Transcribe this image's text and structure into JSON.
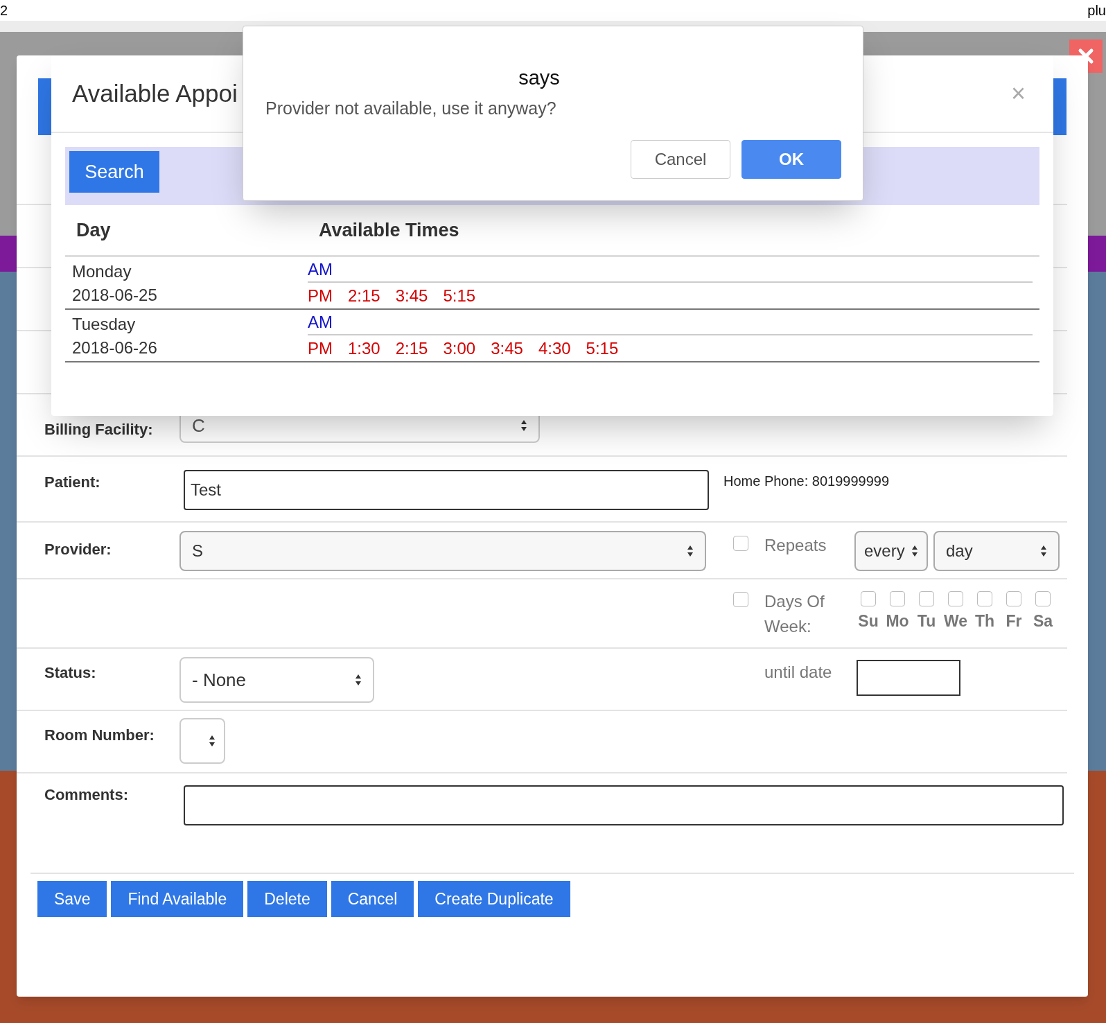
{
  "browser_bar": {
    "left_text": "2",
    "right_text": "plu"
  },
  "appointment_form": {
    "billing_facility": {
      "label": "Billing Facility:",
      "value": "C"
    },
    "patient": {
      "label": "Patient:",
      "value": "Test",
      "home_phone": "Home Phone: 8019999999"
    },
    "provider": {
      "label": "Provider:",
      "value": "S"
    },
    "repeats": {
      "checked": false,
      "label": "Repeats",
      "interval": "every",
      "unit": "day"
    },
    "days_of_week": {
      "checked": false,
      "label": "Days Of Week:",
      "days": [
        {
          "label": "Su",
          "checked": false
        },
        {
          "label": "Mo",
          "checked": false
        },
        {
          "label": "Tu",
          "checked": false
        },
        {
          "label": "We",
          "checked": false
        },
        {
          "label": "Th",
          "checked": false
        },
        {
          "label": "Fr",
          "checked": false
        },
        {
          "label": "Sa",
          "checked": false
        }
      ]
    },
    "status": {
      "label": "Status:",
      "value": "- None"
    },
    "until_date": {
      "label": "until date"
    },
    "room_number": {
      "label": "Room Number:"
    },
    "comments": {
      "label": "Comments:"
    },
    "buttons": [
      "Save",
      "Find Available",
      "Delete",
      "Cancel",
      "Create Duplicate"
    ]
  },
  "available_appointments": {
    "title": "Available Appoi",
    "close": "×",
    "search_button": "Search",
    "columns": [
      "Day",
      "Available Times"
    ],
    "days": [
      {
        "weekday": "Monday",
        "date": "2018-06-25",
        "sessions": [
          {
            "label": "AM",
            "kind": "am"
          },
          {
            "label": "PM",
            "kind": "pm",
            "times": [
              "2:15",
              "3:45",
              "5:15"
            ]
          }
        ]
      },
      {
        "weekday": "Tuesday",
        "date": "2018-06-26",
        "sessions": [
          {
            "label": "AM",
            "kind": "am"
          },
          {
            "label": "PM",
            "kind": "pm",
            "times": [
              "1:30",
              "2:15",
              "3:00",
              "3:45",
              "4:30",
              "5:15"
            ]
          }
        ]
      }
    ]
  },
  "alert": {
    "title": "says",
    "message": "Provider not available, use it anyway?",
    "buttons": [
      {
        "label": "Cancel",
        "kind": "secondary"
      },
      {
        "label": "OK",
        "kind": "primary"
      }
    ]
  }
}
